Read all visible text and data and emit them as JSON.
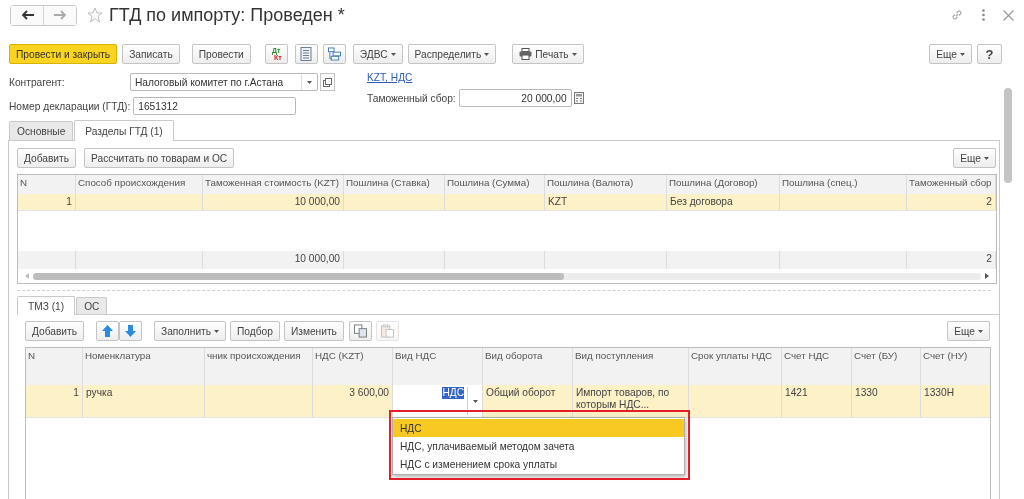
{
  "window": {
    "title": "ГТД по импорту: Проведен *"
  },
  "toolbar": [
    {
      "kind": "primary",
      "label": "Провести и закрыть"
    },
    {
      "kind": "text",
      "label": "Записать"
    },
    {
      "kind": "text",
      "label": "Провести"
    },
    {
      "kind": "dtkt",
      "top": "Дт",
      "bottom": "Кт"
    },
    {
      "kind": "list"
    },
    {
      "kind": "structure"
    },
    {
      "kind": "menu",
      "label": "ЭДВС"
    },
    {
      "kind": "menu",
      "label": "Распределить"
    },
    {
      "kind": "print",
      "label": "Печать"
    }
  ],
  "toolbar_right": [
    {
      "kind": "menu",
      "label": "Еще"
    },
    {
      "kind": "help",
      "label": "?"
    }
  ],
  "fields": {
    "counterparty": {
      "label": "Контрагент:",
      "value": "Налоговый комитет по г.Астана"
    },
    "declaration": {
      "label": "Номер декларации (ГТД):",
      "value": "1651312"
    },
    "currency_link": "KZT, НДС",
    "customs_fee": {
      "label": "Таможенный сбор:",
      "value": "20 000,00"
    }
  },
  "tabs": [
    {
      "label": "Основные",
      "selected": false
    },
    {
      "label": "Разделы ГТД (1)",
      "selected": true
    }
  ],
  "sections": {
    "buttons": [
      "Добавить",
      "Рассчитать по товарам и ОС"
    ],
    "more": "Еще",
    "table": {
      "columns": [
        "N",
        "Способ происхождения",
        "Таможенная стоимость (KZT)",
        "Пошлина (Ставка)",
        "Пошлина (Сумма)",
        "Пошлина (Валюта)",
        "Пошлина (Договор)",
        "Пошлина (спец.)",
        "Таможенный сбор"
      ],
      "rows": [
        {
          "selected": true,
          "cells": [
            {
              "kind": "number",
              "text": "1"
            },
            {
              "kind": "empty"
            },
            {
              "kind": "number",
              "text": "10 000,00"
            },
            {
              "kind": "empty"
            },
            {
              "kind": "empty"
            },
            {
              "kind": "text",
              "text": "KZT"
            },
            {
              "kind": "text",
              "text": "Без договора"
            },
            {
              "kind": "empty"
            },
            {
              "kind": "number",
              "text": "2"
            }
          ]
        }
      ],
      "totals": [
        {
          "kind": "empty"
        },
        {
          "kind": "empty"
        },
        {
          "kind": "number",
          "text": "10 000,00"
        },
        {
          "kind": "empty"
        },
        {
          "kind": "empty"
        },
        {
          "kind": "empty"
        },
        {
          "kind": "empty"
        },
        {
          "kind": "empty"
        },
        {
          "kind": "number",
          "text": "2"
        }
      ]
    }
  },
  "goods_tabs": [
    {
      "label": "ТМЗ (1)",
      "selected": true
    },
    {
      "label": "ОС",
      "selected": false
    }
  ],
  "goods": {
    "toolbar": [
      {
        "kind": "text",
        "label": "Добавить",
        "disabled": false
      },
      {
        "kind": "arrows",
        "disabled": false
      },
      {
        "kind": "menu",
        "label": "Заполнить",
        "disabled": false
      },
      {
        "kind": "text",
        "label": "Подбор",
        "disabled": false
      },
      {
        "kind": "text",
        "label": "Изменить",
        "disabled": false
      },
      {
        "kind": "copy",
        "disabled": false
      },
      {
        "kind": "paste",
        "disabled": true
      }
    ],
    "more": "Еще",
    "table": {
      "columns": [
        "N",
        "Номенклатура",
        "чник происхождения",
        "НДС (KZT)",
        "Вид НДС",
        "Вид оборота",
        "Вид поступления",
        "Срок уплаты НДС",
        "Счет НДС",
        "Счет (БУ)",
        "Счет (НУ)"
      ],
      "rows": [
        {
          "selected": true,
          "cells": [
            {
              "kind": "number",
              "text": "1"
            },
            {
              "kind": "text",
              "text": "ручка"
            },
            {
              "kind": "empty"
            },
            {
              "kind": "number",
              "text": "3 600,00"
            },
            {
              "kind": "editor",
              "value": "НДС"
            },
            {
              "kind": "text",
              "text": "Общий оборот"
            },
            {
              "kind": "text",
              "text": "Импорт товаров, по которым НДС..."
            },
            {
              "kind": "empty"
            },
            {
              "kind": "text",
              "text": "1421"
            },
            {
              "kind": "text",
              "text": "1330"
            },
            {
              "kind": "text",
              "text": "1330Н"
            }
          ]
        }
      ]
    }
  },
  "dropdown": {
    "items": [
      {
        "label": "НДС",
        "selected": true
      },
      {
        "label": "НДС, уплачиваемый методом зачета",
        "selected": false
      },
      {
        "label": "НДС с изменением срока уплаты",
        "selected": false
      }
    ]
  }
}
